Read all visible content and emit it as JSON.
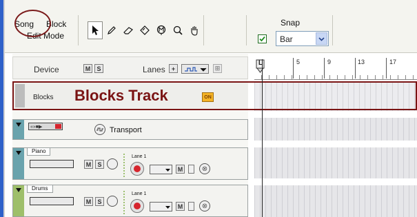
{
  "toolbar": {
    "mode": {
      "song": "Song",
      "block": "Block",
      "label": "Edit Mode"
    },
    "tools": [
      {
        "icon": "arrow-icon",
        "active": true
      },
      {
        "icon": "pencil-icon",
        "active": false
      },
      {
        "icon": "eraser-icon",
        "active": false
      },
      {
        "icon": "razor-icon",
        "active": false
      },
      {
        "icon": "mute-tool-icon",
        "active": false
      },
      {
        "icon": "magnify-icon",
        "active": false
      },
      {
        "icon": "hand-icon",
        "active": false
      }
    ],
    "snap": {
      "label": "Snap",
      "checked": true,
      "value": "Bar"
    }
  },
  "device_row": {
    "label": "Device",
    "mute": "M",
    "solo": "S",
    "lanes_label": "Lanes",
    "lanes_add": "+"
  },
  "blocks_track": {
    "label": "Blocks",
    "title": "Blocks Track",
    "on_label": "ON"
  },
  "transport_track": {
    "label": "Transport"
  },
  "tracks": [
    {
      "name": "Piano",
      "lane": "Lane 1",
      "mute": "M",
      "solo": "S",
      "lane_mute": "M"
    },
    {
      "name": "Drums",
      "lane": "Lane 1",
      "mute": "M",
      "solo": "S",
      "lane_mute": "M"
    }
  ],
  "ruler": {
    "bars": [
      "5",
      "9",
      "13",
      "17"
    ],
    "marker": "L"
  },
  "colors": {
    "accent_blue": "#2f61c9",
    "annotation_red": "#7a1414",
    "on_orange": "#f4b326",
    "transport_teal": "#6aa3ad",
    "track_green": "#9ebf6a"
  }
}
